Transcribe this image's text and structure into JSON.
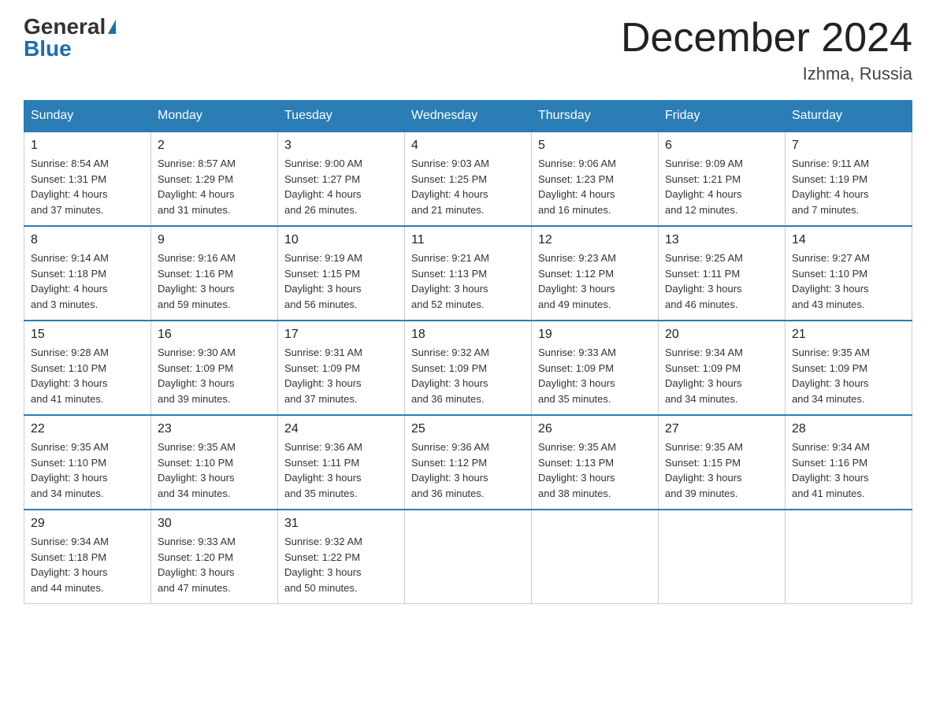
{
  "logo": {
    "general": "General",
    "blue": "Blue"
  },
  "title": "December 2024",
  "location": "Izhma, Russia",
  "days_of_week": [
    "Sunday",
    "Monday",
    "Tuesday",
    "Wednesday",
    "Thursday",
    "Friday",
    "Saturday"
  ],
  "weeks": [
    [
      {
        "day": "1",
        "info": "Sunrise: 8:54 AM\nSunset: 1:31 PM\nDaylight: 4 hours\nand 37 minutes."
      },
      {
        "day": "2",
        "info": "Sunrise: 8:57 AM\nSunset: 1:29 PM\nDaylight: 4 hours\nand 31 minutes."
      },
      {
        "day": "3",
        "info": "Sunrise: 9:00 AM\nSunset: 1:27 PM\nDaylight: 4 hours\nand 26 minutes."
      },
      {
        "day": "4",
        "info": "Sunrise: 9:03 AM\nSunset: 1:25 PM\nDaylight: 4 hours\nand 21 minutes."
      },
      {
        "day": "5",
        "info": "Sunrise: 9:06 AM\nSunset: 1:23 PM\nDaylight: 4 hours\nand 16 minutes."
      },
      {
        "day": "6",
        "info": "Sunrise: 9:09 AM\nSunset: 1:21 PM\nDaylight: 4 hours\nand 12 minutes."
      },
      {
        "day": "7",
        "info": "Sunrise: 9:11 AM\nSunset: 1:19 PM\nDaylight: 4 hours\nand 7 minutes."
      }
    ],
    [
      {
        "day": "8",
        "info": "Sunrise: 9:14 AM\nSunset: 1:18 PM\nDaylight: 4 hours\nand 3 minutes."
      },
      {
        "day": "9",
        "info": "Sunrise: 9:16 AM\nSunset: 1:16 PM\nDaylight: 3 hours\nand 59 minutes."
      },
      {
        "day": "10",
        "info": "Sunrise: 9:19 AM\nSunset: 1:15 PM\nDaylight: 3 hours\nand 56 minutes."
      },
      {
        "day": "11",
        "info": "Sunrise: 9:21 AM\nSunset: 1:13 PM\nDaylight: 3 hours\nand 52 minutes."
      },
      {
        "day": "12",
        "info": "Sunrise: 9:23 AM\nSunset: 1:12 PM\nDaylight: 3 hours\nand 49 minutes."
      },
      {
        "day": "13",
        "info": "Sunrise: 9:25 AM\nSunset: 1:11 PM\nDaylight: 3 hours\nand 46 minutes."
      },
      {
        "day": "14",
        "info": "Sunrise: 9:27 AM\nSunset: 1:10 PM\nDaylight: 3 hours\nand 43 minutes."
      }
    ],
    [
      {
        "day": "15",
        "info": "Sunrise: 9:28 AM\nSunset: 1:10 PM\nDaylight: 3 hours\nand 41 minutes."
      },
      {
        "day": "16",
        "info": "Sunrise: 9:30 AM\nSunset: 1:09 PM\nDaylight: 3 hours\nand 39 minutes."
      },
      {
        "day": "17",
        "info": "Sunrise: 9:31 AM\nSunset: 1:09 PM\nDaylight: 3 hours\nand 37 minutes."
      },
      {
        "day": "18",
        "info": "Sunrise: 9:32 AM\nSunset: 1:09 PM\nDaylight: 3 hours\nand 36 minutes."
      },
      {
        "day": "19",
        "info": "Sunrise: 9:33 AM\nSunset: 1:09 PM\nDaylight: 3 hours\nand 35 minutes."
      },
      {
        "day": "20",
        "info": "Sunrise: 9:34 AM\nSunset: 1:09 PM\nDaylight: 3 hours\nand 34 minutes."
      },
      {
        "day": "21",
        "info": "Sunrise: 9:35 AM\nSunset: 1:09 PM\nDaylight: 3 hours\nand 34 minutes."
      }
    ],
    [
      {
        "day": "22",
        "info": "Sunrise: 9:35 AM\nSunset: 1:10 PM\nDaylight: 3 hours\nand 34 minutes."
      },
      {
        "day": "23",
        "info": "Sunrise: 9:35 AM\nSunset: 1:10 PM\nDaylight: 3 hours\nand 34 minutes."
      },
      {
        "day": "24",
        "info": "Sunrise: 9:36 AM\nSunset: 1:11 PM\nDaylight: 3 hours\nand 35 minutes."
      },
      {
        "day": "25",
        "info": "Sunrise: 9:36 AM\nSunset: 1:12 PM\nDaylight: 3 hours\nand 36 minutes."
      },
      {
        "day": "26",
        "info": "Sunrise: 9:35 AM\nSunset: 1:13 PM\nDaylight: 3 hours\nand 38 minutes."
      },
      {
        "day": "27",
        "info": "Sunrise: 9:35 AM\nSunset: 1:15 PM\nDaylight: 3 hours\nand 39 minutes."
      },
      {
        "day": "28",
        "info": "Sunrise: 9:34 AM\nSunset: 1:16 PM\nDaylight: 3 hours\nand 41 minutes."
      }
    ],
    [
      {
        "day": "29",
        "info": "Sunrise: 9:34 AM\nSunset: 1:18 PM\nDaylight: 3 hours\nand 44 minutes."
      },
      {
        "day": "30",
        "info": "Sunrise: 9:33 AM\nSunset: 1:20 PM\nDaylight: 3 hours\nand 47 minutes."
      },
      {
        "day": "31",
        "info": "Sunrise: 9:32 AM\nSunset: 1:22 PM\nDaylight: 3 hours\nand 50 minutes."
      },
      null,
      null,
      null,
      null
    ]
  ]
}
